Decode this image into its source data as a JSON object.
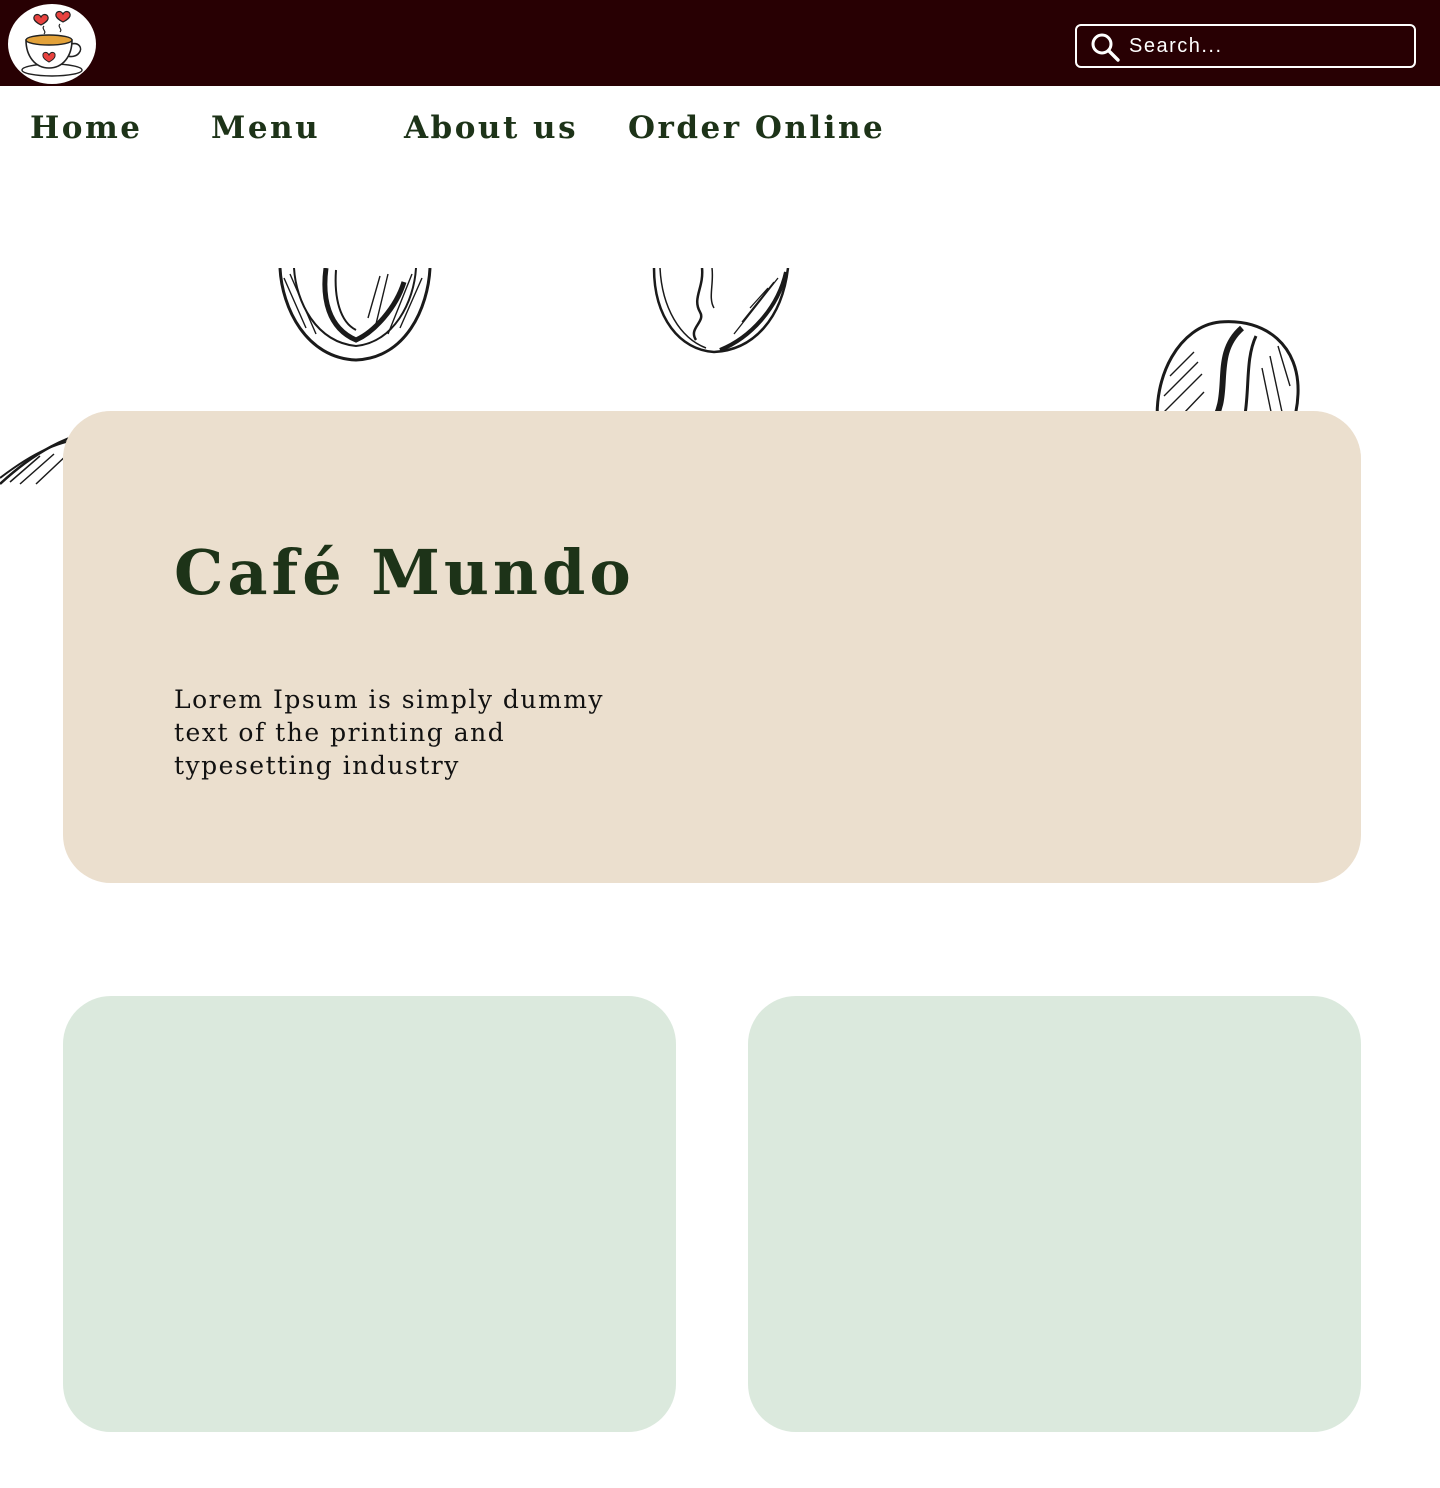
{
  "header": {
    "logo_icon": "coffee-cup-hearts-icon",
    "search": {
      "icon": "search-icon",
      "placeholder": "Search..."
    }
  },
  "nav": {
    "items": [
      {
        "label": "Home"
      },
      {
        "label": "Menu"
      },
      {
        "label": "About us"
      },
      {
        "label": "Order Online"
      }
    ]
  },
  "hero": {
    "title": "Café Mundo",
    "description": "Lorem Ipsum is simply dummy text of the printing and typesetting industry"
  },
  "decorations": {
    "icon": "coffee-bean-icon"
  },
  "colors": {
    "header_bg": "#280003",
    "nav_text": "#1d3318",
    "hero_bg": "#ebdfce",
    "card_bg": "#dbe9dd"
  }
}
